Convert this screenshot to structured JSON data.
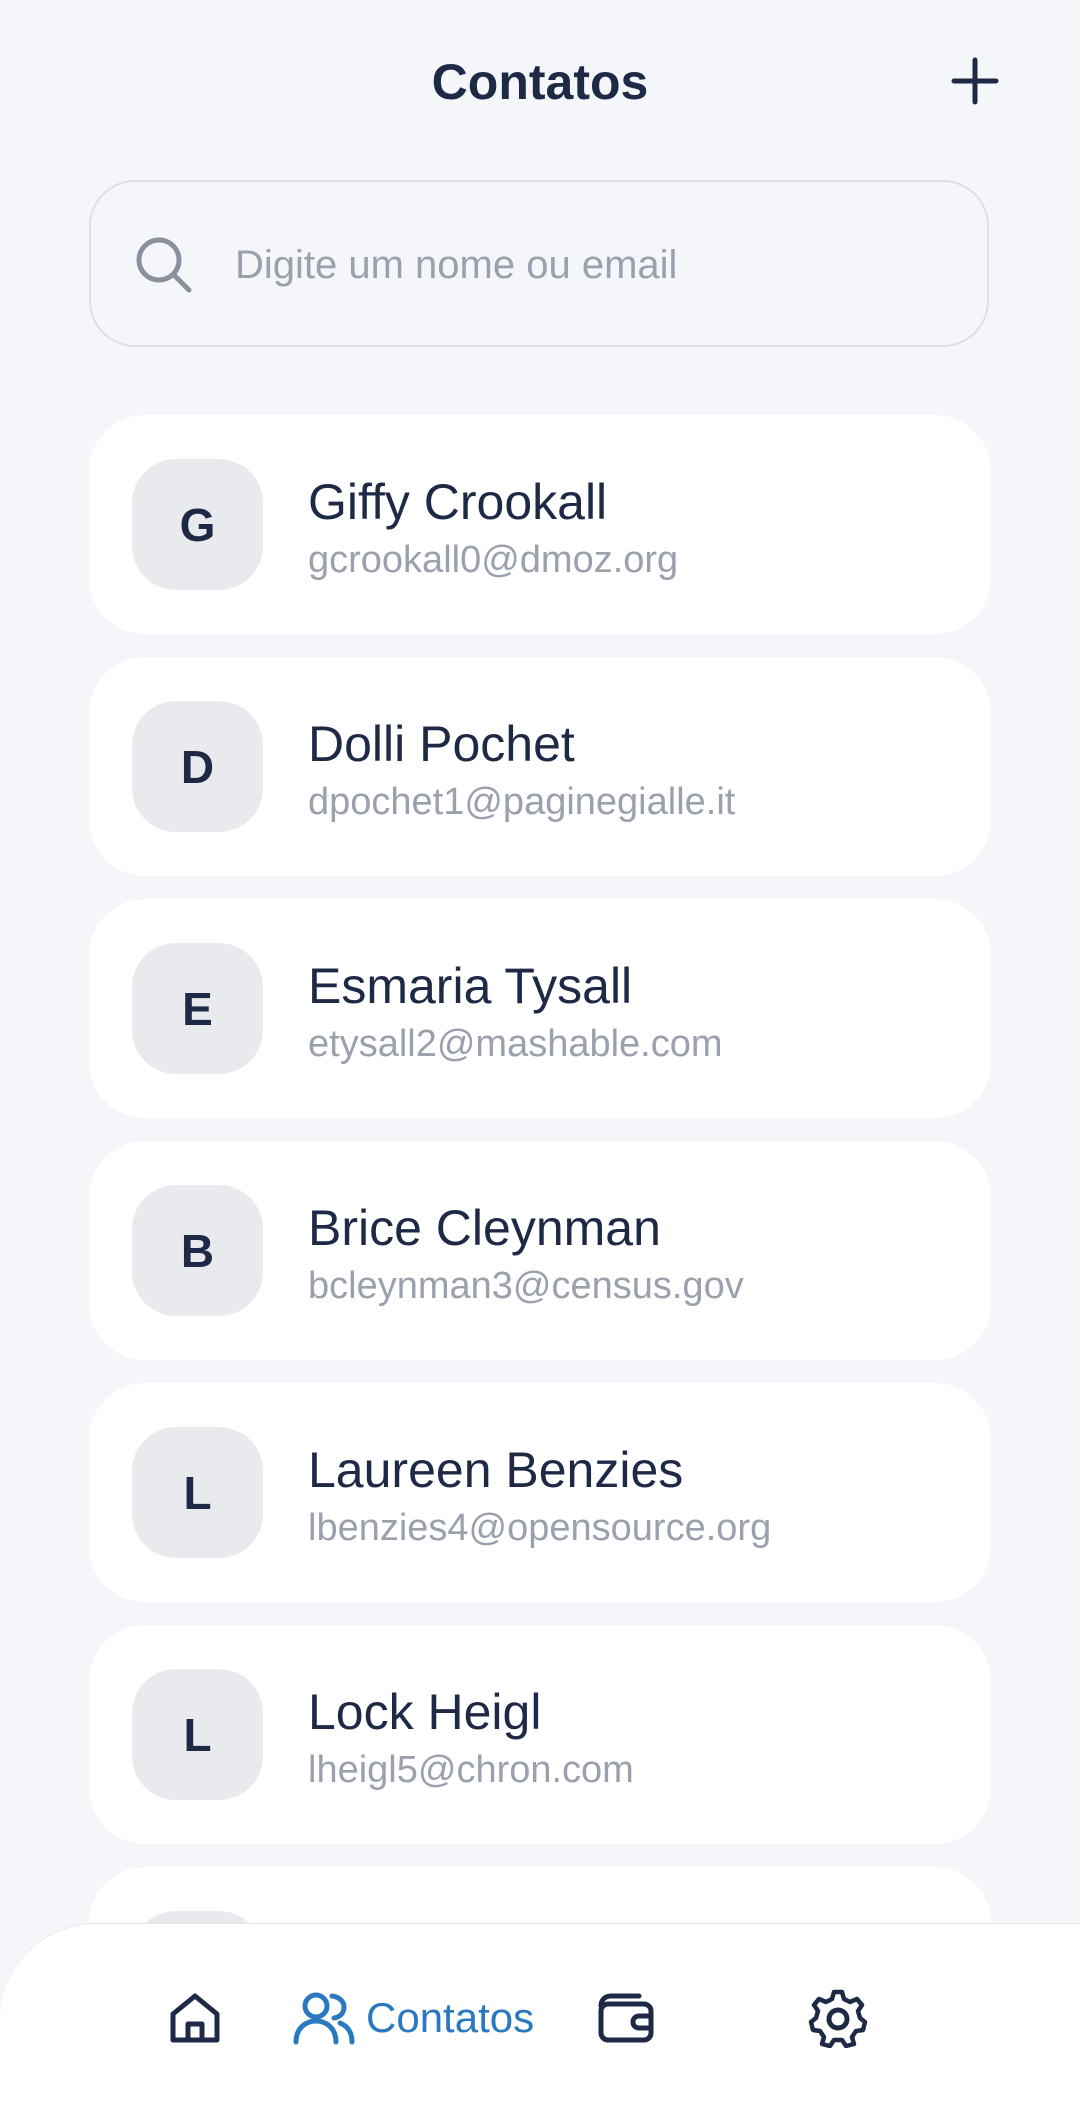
{
  "header": {
    "title": "Contatos"
  },
  "search": {
    "placeholder": "Digite um nome ou email"
  },
  "contacts": [
    {
      "initial": "G",
      "name": "Giffy Crookall",
      "email": "gcrookall0@dmoz.org"
    },
    {
      "initial": "D",
      "name": "Dolli Pochet",
      "email": "dpochet1@paginegialle.it"
    },
    {
      "initial": "E",
      "name": "Esmaria Tysall",
      "email": "etysall2@mashable.com"
    },
    {
      "initial": "B",
      "name": "Brice Cleynman",
      "email": "bcleynman3@census.gov"
    },
    {
      "initial": "L",
      "name": "Laureen Benzies",
      "email": "lbenzies4@opensource.org"
    },
    {
      "initial": "L",
      "name": "Lock Heigl",
      "email": "lheigl5@chron.com"
    },
    {
      "initial": "",
      "name": "",
      "email": ""
    }
  ],
  "nav": {
    "contacts_label": "Contatos",
    "active": "contacts"
  },
  "colors": {
    "accent": "#2a79c0",
    "text_primary": "#1e2a45",
    "text_secondary": "#9aa1ad",
    "background": "#f4f6fa",
    "card": "#ffffff",
    "avatar_bg": "#e8eaee"
  },
  "icons": {
    "add": "plus-icon",
    "search": "search-icon",
    "home": "home-icon",
    "contacts": "users-icon",
    "wallet": "wallet-icon",
    "settings": "gear-icon"
  }
}
